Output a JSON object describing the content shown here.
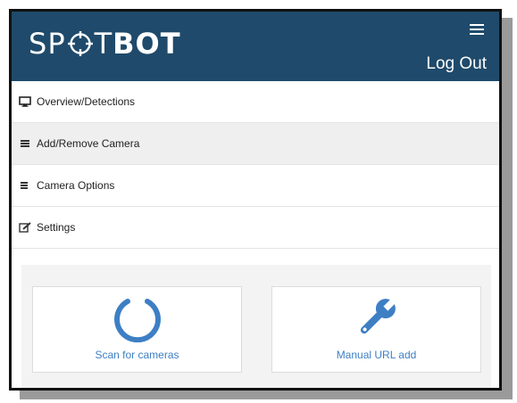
{
  "app": {
    "logo_light": "SP",
    "logo_light2": "T",
    "logo_bold": "BOT",
    "logout_label": "Log Out"
  },
  "nav": {
    "items": [
      {
        "label": "Overview/Detections",
        "icon": "monitor-icon"
      },
      {
        "label": "Add/Remove Camera",
        "icon": "list-icon"
      },
      {
        "label": "Camera Options",
        "icon": "list-icon"
      },
      {
        "label": "Settings",
        "icon": "edit-icon"
      }
    ]
  },
  "actions": {
    "scan_label": "Scan for cameras",
    "manual_label": "Manual URL add"
  },
  "colors": {
    "header": "#1f4a6b",
    "accent": "#3e7fc4"
  }
}
